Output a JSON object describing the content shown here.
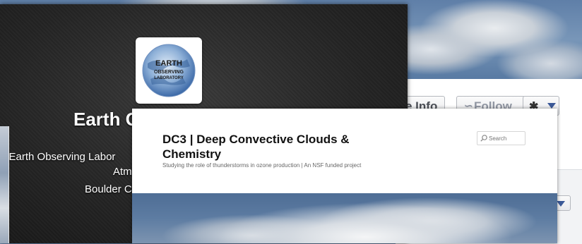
{
  "background_page": {
    "info_button_label": "e Info",
    "follow_button_label": "Follow",
    "follow_icon": "rss-icon",
    "gear_icon": "gear-icon",
    "dropdown_icon": "chevron-down-icon"
  },
  "twitter_profile": {
    "avatar_logo": {
      "line1": "EARTH",
      "line2": "OBSERVING",
      "line3": "LABORATORY"
    },
    "name": "Earth Observing Lab",
    "bio_line1": "e Earth Observing Labor",
    "bio_line2": "Atm",
    "location": "Boulder C"
  },
  "blog": {
    "title": "DC3 | Deep Convective Clouds & Chemistry",
    "tagline": "Studying the role of thunderstorms in ozone production | An NSF funded project",
    "search_placeholder": "Search",
    "search_icon": "search-icon"
  },
  "colors": {
    "fb_blue": "#3b5998",
    "dark_card": "#242424",
    "white": "#ffffff"
  }
}
